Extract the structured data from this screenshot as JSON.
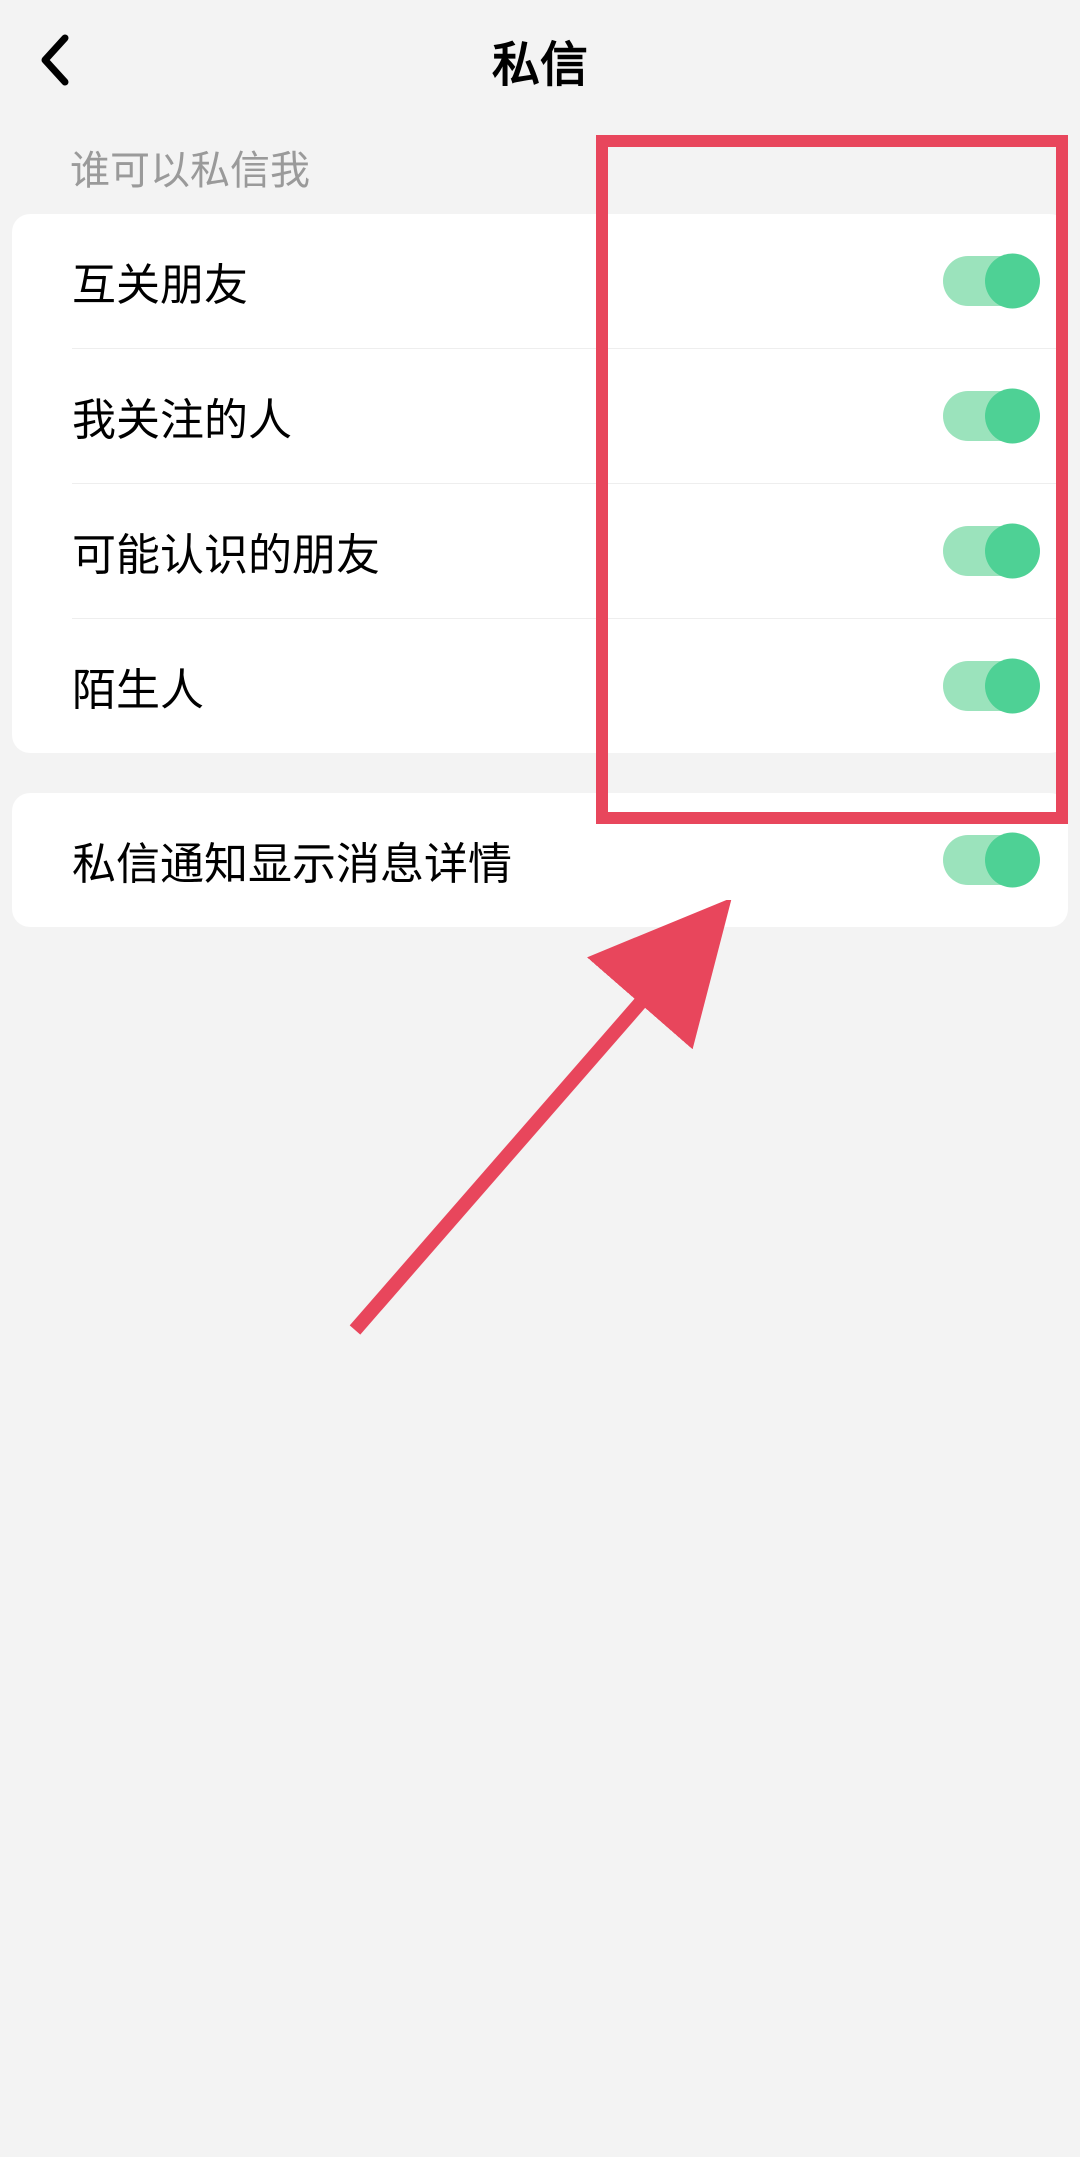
{
  "header": {
    "title": "私信"
  },
  "section1": {
    "label": "谁可以私信我",
    "items": [
      {
        "label": "互关朋友",
        "on": true
      },
      {
        "label": "我关注的人",
        "on": true
      },
      {
        "label": "可能认识的朋友",
        "on": true
      },
      {
        "label": "陌生人",
        "on": true
      }
    ]
  },
  "section2": {
    "items": [
      {
        "label": "私信通知显示消息详情",
        "on": true
      }
    ]
  },
  "colors": {
    "toggle_track": "#9be3bc",
    "toggle_knob": "#4ed195",
    "annotation": "#e8465c"
  }
}
